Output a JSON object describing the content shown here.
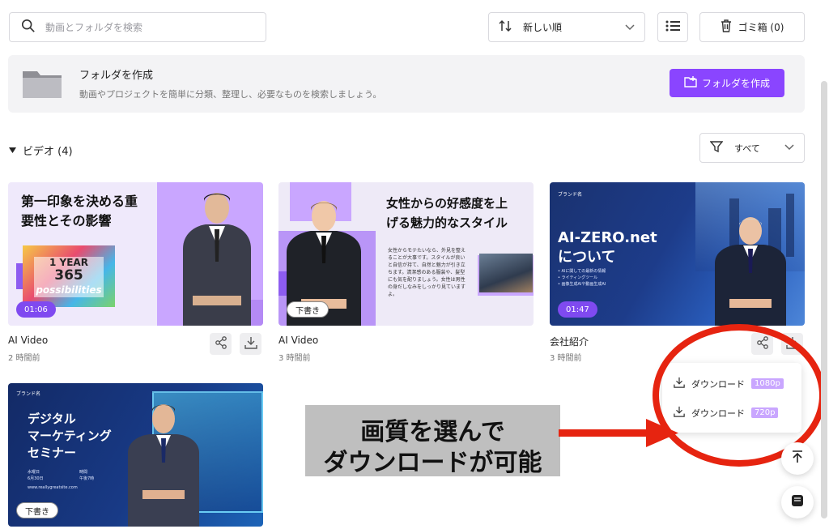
{
  "search": {
    "placeholder": "動画とフォルダを検索"
  },
  "sort": {
    "label": "新しい順"
  },
  "trash": {
    "label": "ゴミ箱 (0)"
  },
  "folder_banner": {
    "title": "フォルダを作成",
    "description": "動画やプロジェクトを簡単に分類、整理し、必要なものを検索しましょう。",
    "button": "フォルダを作成"
  },
  "section": {
    "title": "ビデオ (4)"
  },
  "filter": {
    "label": "すべて"
  },
  "cards": [
    {
      "title": "AI Video",
      "time": "2 時間前",
      "badge": "01:06",
      "headline_lines": [
        "第一印象を決める重",
        "要性とその影響"
      ],
      "image_text": [
        "1 YEAR",
        "365",
        "possibilities"
      ]
    },
    {
      "title": "AI Video",
      "time": "3 時間前",
      "badge": "下書き",
      "headline_lines": [
        "女性からの好感度を上",
        "げる魅力的なスタイル"
      ],
      "body_lines": [
        "女性からモテたいなら、外見を整え",
        "ることが大事です。スタイルが良い",
        "と自信が持て、自然と魅力が引き立",
        "ちます。清潔感のある服装や、髪型",
        "にも気を配りましょう。女性は男性",
        "の身だしなみをしっかり見ています",
        "よ。"
      ]
    },
    {
      "title": "会社紹介",
      "time": "3 時間前",
      "badge": "01:47",
      "brand": "ブランド名",
      "headline_lines": [
        "AI-ZERO.net",
        "について"
      ],
      "bullets": [
        "• AIに関しての最新の情報",
        "• ライティングツール",
        "• 画像生成AIや動画生成AI"
      ]
    },
    {
      "title": "",
      "time": "",
      "badge": "下書き",
      "brand": "ブランド名",
      "headline_lines": [
        "デジタル",
        "マーケティング",
        "セミナー"
      ],
      "info": [
        "水曜日",
        "6月30日",
        "時間",
        "午後7時"
      ],
      "website": "www.reallygreatsite.com"
    }
  ],
  "download_menu": [
    {
      "label": "ダウンロード",
      "quality": "1080p"
    },
    {
      "label": "ダウンロード",
      "quality": "720p"
    }
  ],
  "callout": {
    "line1": "画質を選んで",
    "line2": "ダウンロードが可能"
  },
  "colors": {
    "accent": "#8a45ff",
    "annotation": "#e62410"
  }
}
